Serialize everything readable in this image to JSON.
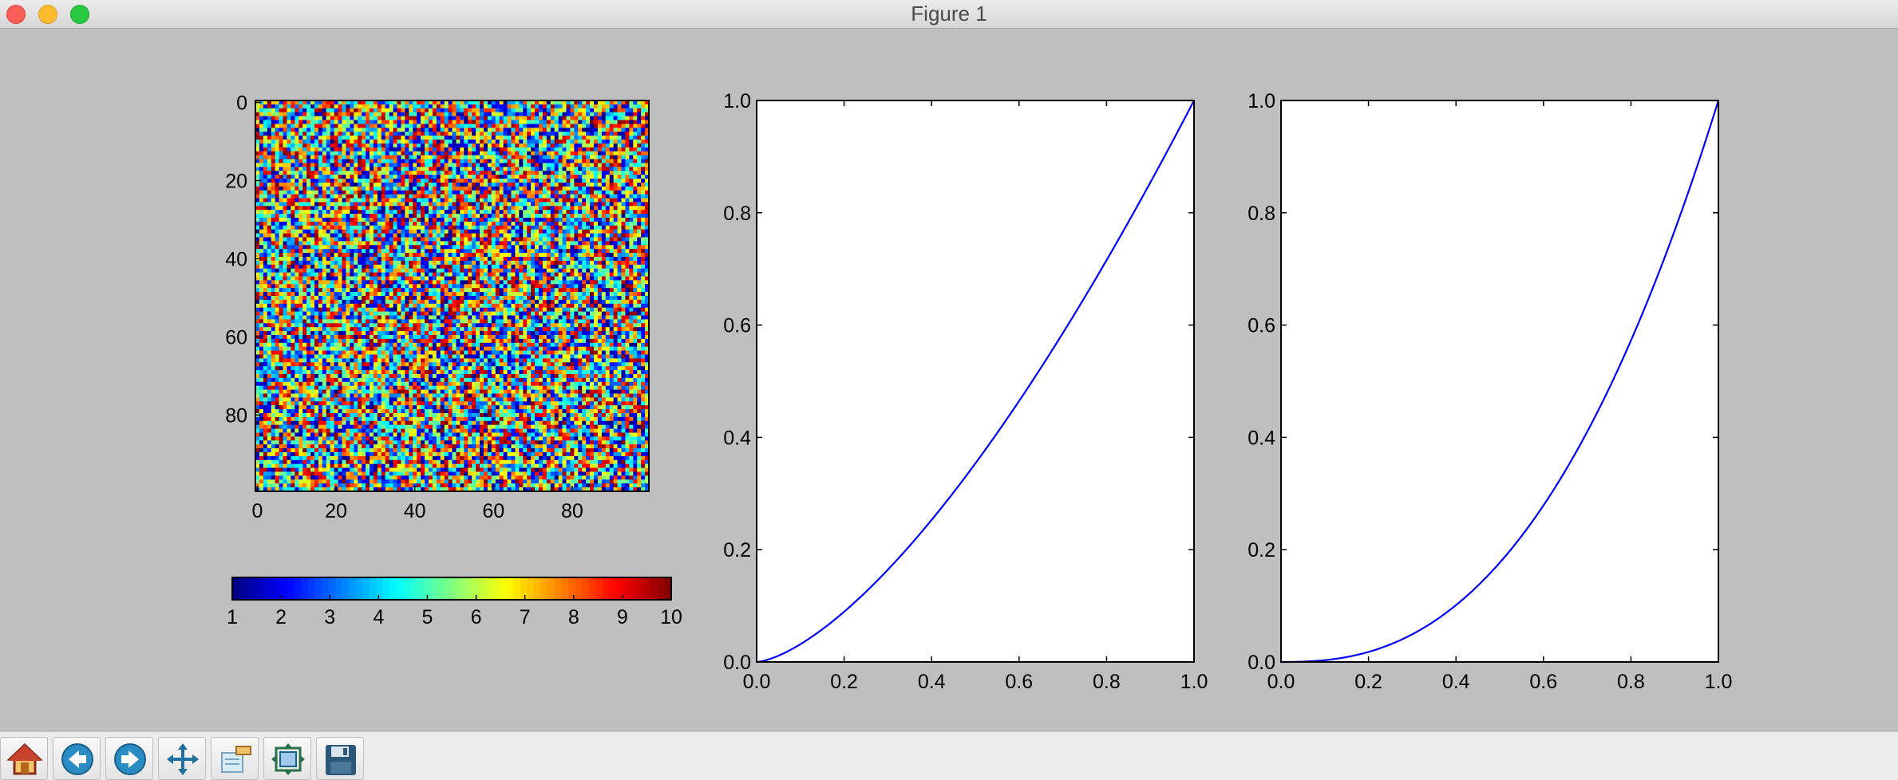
{
  "window": {
    "title": "Figure 1",
    "controls": [
      "close",
      "minimize",
      "maximize"
    ]
  },
  "chart_data": [
    {
      "type": "heatmap",
      "rows": 100,
      "cols": 100,
      "cmap": "jet",
      "value_range": [
        1,
        10
      ],
      "xticks": [
        "0",
        "20",
        "40",
        "60",
        "80"
      ],
      "yticks": [
        "0",
        "20",
        "40",
        "60",
        "80"
      ],
      "colorbar": {
        "orientation": "horizontal",
        "ticks": [
          "1",
          "2",
          "3",
          "4",
          "5",
          "6",
          "7",
          "8",
          "9",
          "10"
        ]
      }
    },
    {
      "type": "line",
      "function": "y = x^1.5",
      "x": [
        0,
        0.1,
        0.2,
        0.3,
        0.4,
        0.5,
        0.6,
        0.7,
        0.8,
        0.9,
        1.0
      ],
      "y": [
        0,
        0.032,
        0.089,
        0.164,
        0.253,
        0.354,
        0.465,
        0.586,
        0.716,
        0.854,
        1.0
      ],
      "xlim": [
        0,
        1
      ],
      "ylim": [
        0,
        1
      ],
      "xticks": [
        "0.0",
        "0.2",
        "0.4",
        "0.6",
        "0.8",
        "1.0"
      ],
      "yticks": [
        "0.0",
        "0.2",
        "0.4",
        "0.6",
        "0.8",
        "1.0"
      ],
      "color": "#0000ff",
      "grid": false
    },
    {
      "type": "line",
      "function": "y = x^2.5",
      "x": [
        0,
        0.1,
        0.2,
        0.3,
        0.4,
        0.5,
        0.6,
        0.7,
        0.8,
        0.9,
        1.0
      ],
      "y": [
        0,
        0.003,
        0.018,
        0.049,
        0.101,
        0.177,
        0.279,
        0.41,
        0.572,
        0.768,
        1.0
      ],
      "xlim": [
        0,
        1
      ],
      "ylim": [
        0,
        1
      ],
      "xticks": [
        "0.0",
        "0.2",
        "0.4",
        "0.6",
        "0.8",
        "1.0"
      ],
      "yticks": [
        "0.0",
        "0.2",
        "0.4",
        "0.6",
        "0.8",
        "1.0"
      ],
      "color": "#0000ff",
      "grid": false
    }
  ],
  "toolbar": {
    "buttons": [
      {
        "id": "home",
        "icon": "home-icon"
      },
      {
        "id": "back",
        "icon": "back-arrow-icon"
      },
      {
        "id": "forward",
        "icon": "forward-arrow-icon"
      },
      {
        "id": "pan",
        "icon": "move-icon"
      },
      {
        "id": "zoom",
        "icon": "zoom-rect-icon"
      },
      {
        "id": "subplots",
        "icon": "subplots-icon"
      },
      {
        "id": "save",
        "icon": "floppy-disk-icon"
      }
    ]
  }
}
